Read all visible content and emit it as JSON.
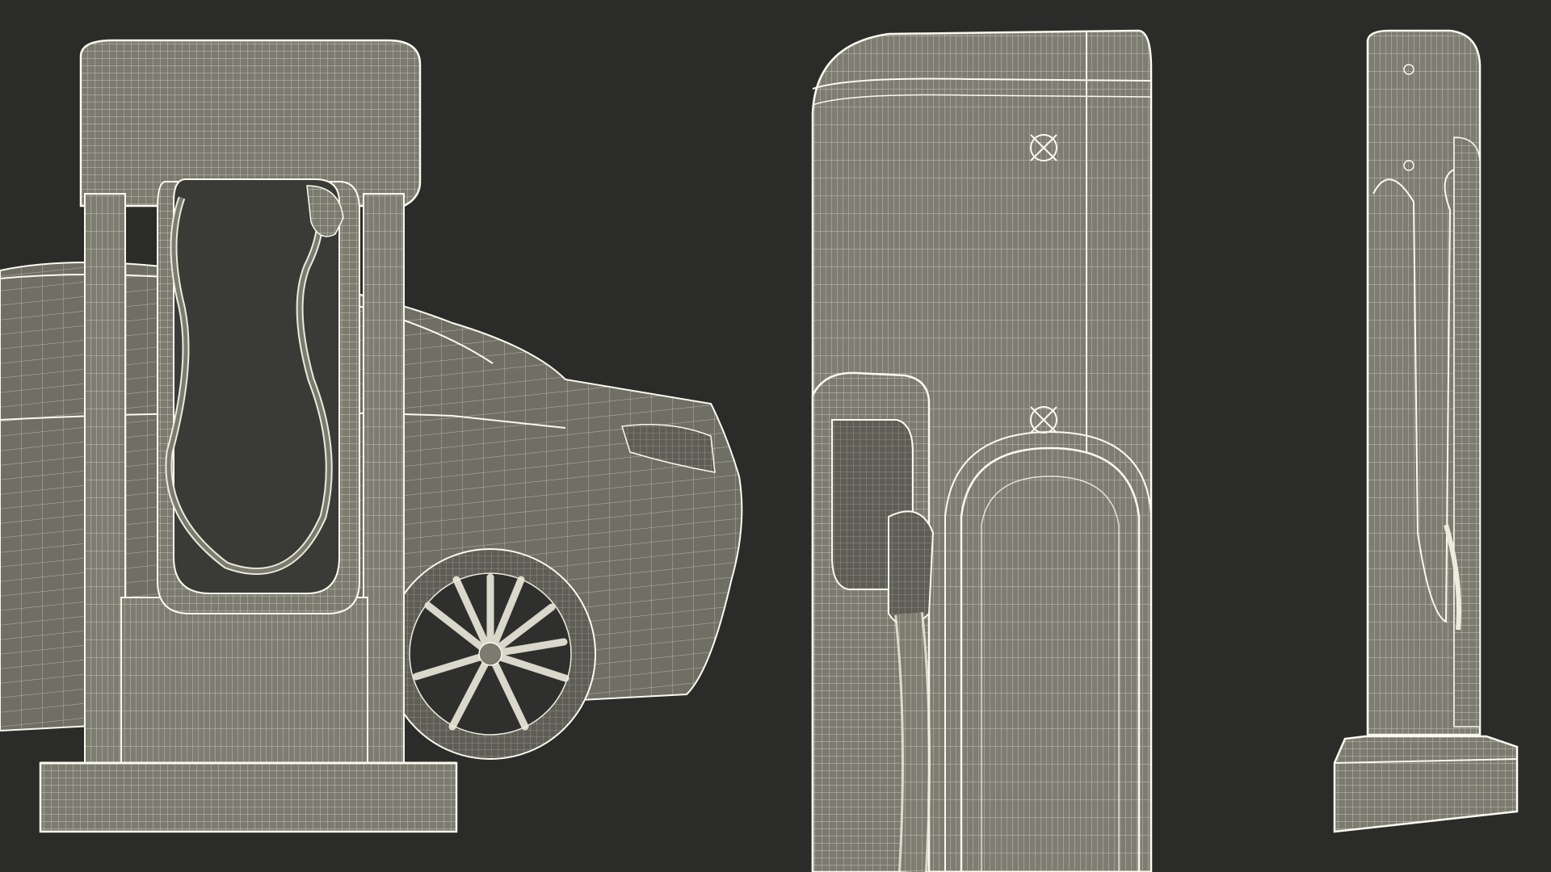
{
  "scene": {
    "background": "#2b2b2a",
    "surface_fill": "#7b7b70",
    "surface_fill_dark": "#64645b",
    "wire_color": "#ecebdc",
    "outline_color": "#fbfaee",
    "views": [
      {
        "name": "charger-front-with-car",
        "subject": "ev-charging-station-front"
      },
      {
        "name": "charger-three-quarter-closeup",
        "subject": "ev-charging-station-detail"
      },
      {
        "name": "charger-side",
        "subject": "ev-charging-station-side"
      }
    ]
  }
}
